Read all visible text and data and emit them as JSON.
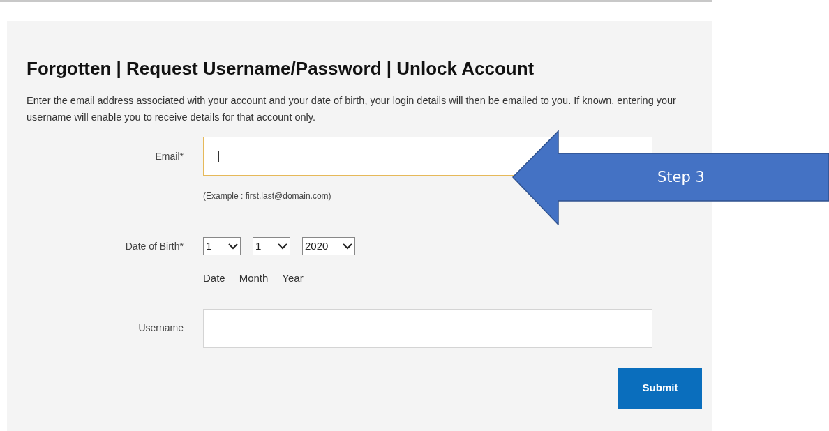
{
  "title": "Forgotten | Request Username/Password | Unlock Account",
  "intro": "Enter the email address associated with your account and your date of birth, your login details will then be emailed to you. If known, entering your username will enable you to receive details for that account only.",
  "email": {
    "label": "Email*",
    "focused": true,
    "hint": "(Example : first.last@domain.com)"
  },
  "date_of_birth": {
    "label": "Date of Birth*",
    "selects": [
      {
        "value": "1",
        "caption": "Date"
      },
      {
        "value": "1",
        "caption": "Month"
      },
      {
        "value": "2020",
        "caption": "Year"
      }
    ]
  },
  "username": {
    "label": "Username",
    "focused": false
  },
  "submit": "Submit",
  "callout": {
    "text": "Step 3"
  }
}
